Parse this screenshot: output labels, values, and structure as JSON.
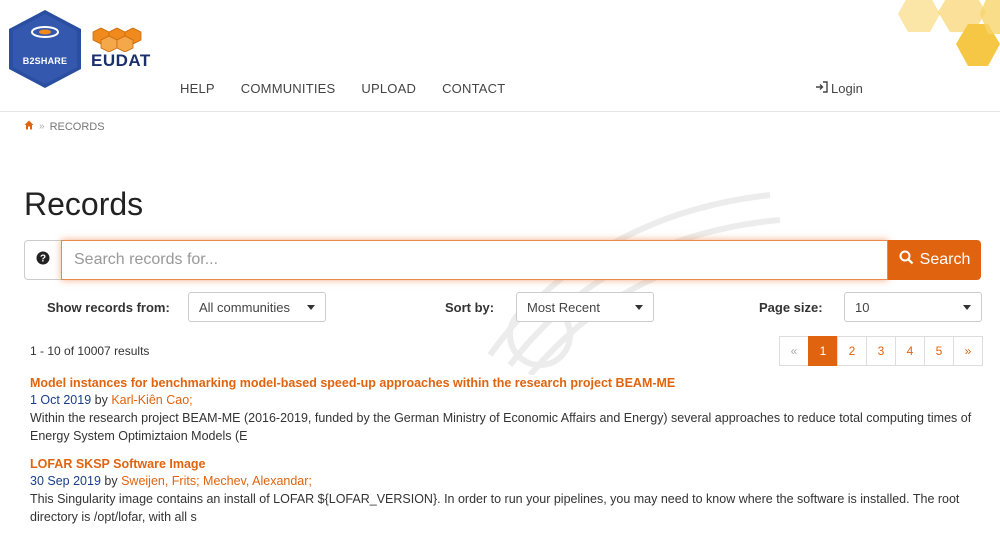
{
  "brand": {
    "b2share_label": "B2SHARE",
    "eudat_label": "EUDAT"
  },
  "nav": {
    "items": [
      "HELP",
      "COMMUNITIES",
      "UPLOAD",
      "CONTACT"
    ],
    "login": "Login"
  },
  "breadcrumb": {
    "current": "RECORDS"
  },
  "page": {
    "title": "Records"
  },
  "search": {
    "placeholder": "Search records for...",
    "button_label": "Search"
  },
  "filters": {
    "show_from_label": "Show records from:",
    "show_from_value": "All communities",
    "sort_label": "Sort by:",
    "sort_value": "Most Recent",
    "page_size_label": "Page size:",
    "page_size_value": "10"
  },
  "results": {
    "count_text": "1 - 10 of 10007 results"
  },
  "pagination": {
    "prev": "«",
    "pages": [
      "1",
      "2",
      "3",
      "4",
      "5"
    ],
    "next": "»",
    "active": "1"
  },
  "records": [
    {
      "title": "Model instances for benchmarking model-based speed-up approaches within the research project BEAM-ME",
      "date": "1 Oct 2019",
      "by": "by",
      "authors": "Karl-Kiên Cao;",
      "description": "Within the research project BEAM-ME (2016-2019, funded by the German Ministry of Economic Affairs and Energy) several approaches to reduce total computing times of Energy System Optimiztaion Models (E"
    },
    {
      "title": "LOFAR SKSP Software Image",
      "date": "30 Sep 2019",
      "by": "by",
      "authors": "Sweijen, Frits; Mechev, Alexandar;",
      "description": "This Singularity image contains an install of LOFAR ${LOFAR_VERSION}. In order to run your pipelines, you may need to know where the software is installed. The root directory is /opt/lofar, with all s"
    }
  ],
  "colors": {
    "accent": "#e0640f",
    "brand_blue": "#2a4fa0",
    "eudat_orange": "#f08a1c",
    "hex_yellow": "#f6c744"
  }
}
